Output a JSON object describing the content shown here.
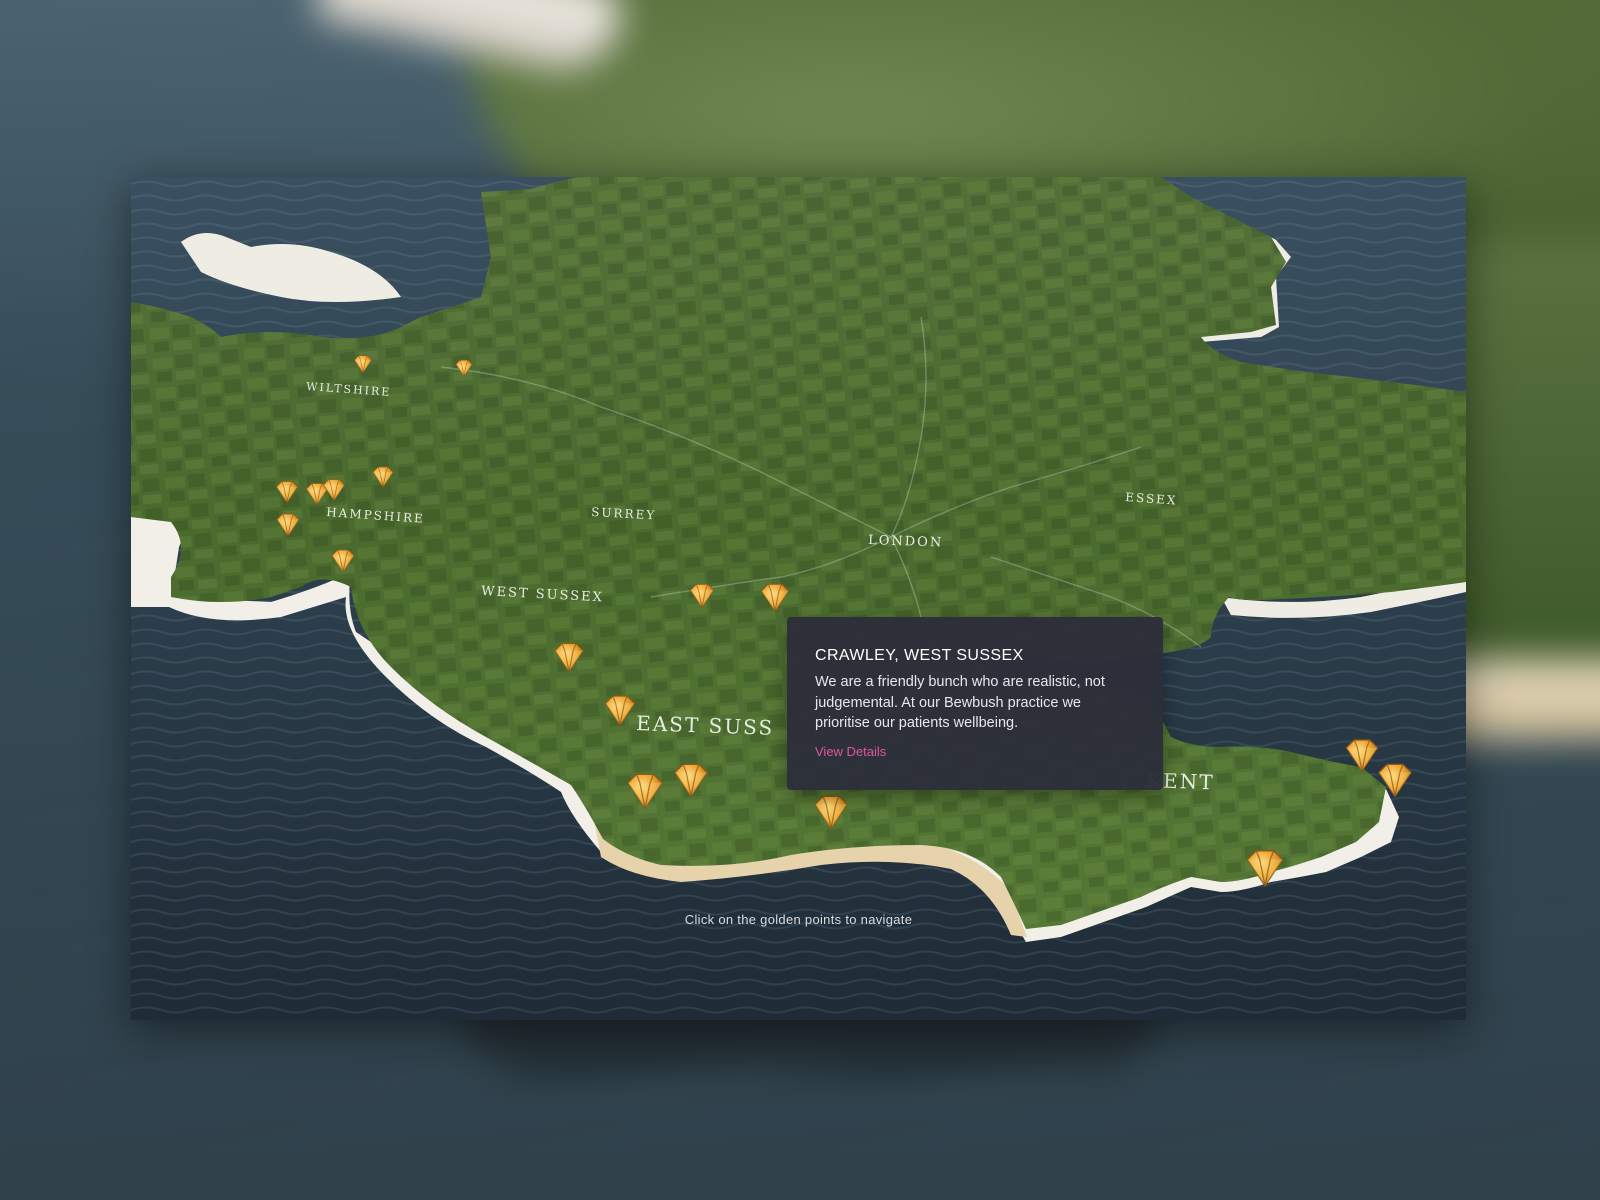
{
  "map": {
    "region_labels": {
      "wiltshire": "WILTSHIRE",
      "hampshire": "HAMPSHIRE",
      "surrey": "SURREY",
      "london": "LONDON",
      "essex": "ESSEX",
      "west_sussex": "WEST SUSSEX",
      "east_sussex": "EAST SUSS",
      "kent": "KENT"
    },
    "pin_icon": "gold-gem-icon",
    "colors": {
      "land": "#4c6a2f",
      "sea": "#2b3b48",
      "cliff": "#f2f0ea",
      "beach": "#e2cfa8",
      "pin_gold": "#e8a833"
    }
  },
  "info_card": {
    "title": "CRAWLEY, WEST SUSSEX",
    "description": "We are a friendly bunch who are realistic, not judgemental. At our Bewbush practice we prioritise our patients wellbeing.",
    "link_label": "View Details",
    "link_color": "#e0559e"
  },
  "hint": "Click on the golden points to navigate"
}
